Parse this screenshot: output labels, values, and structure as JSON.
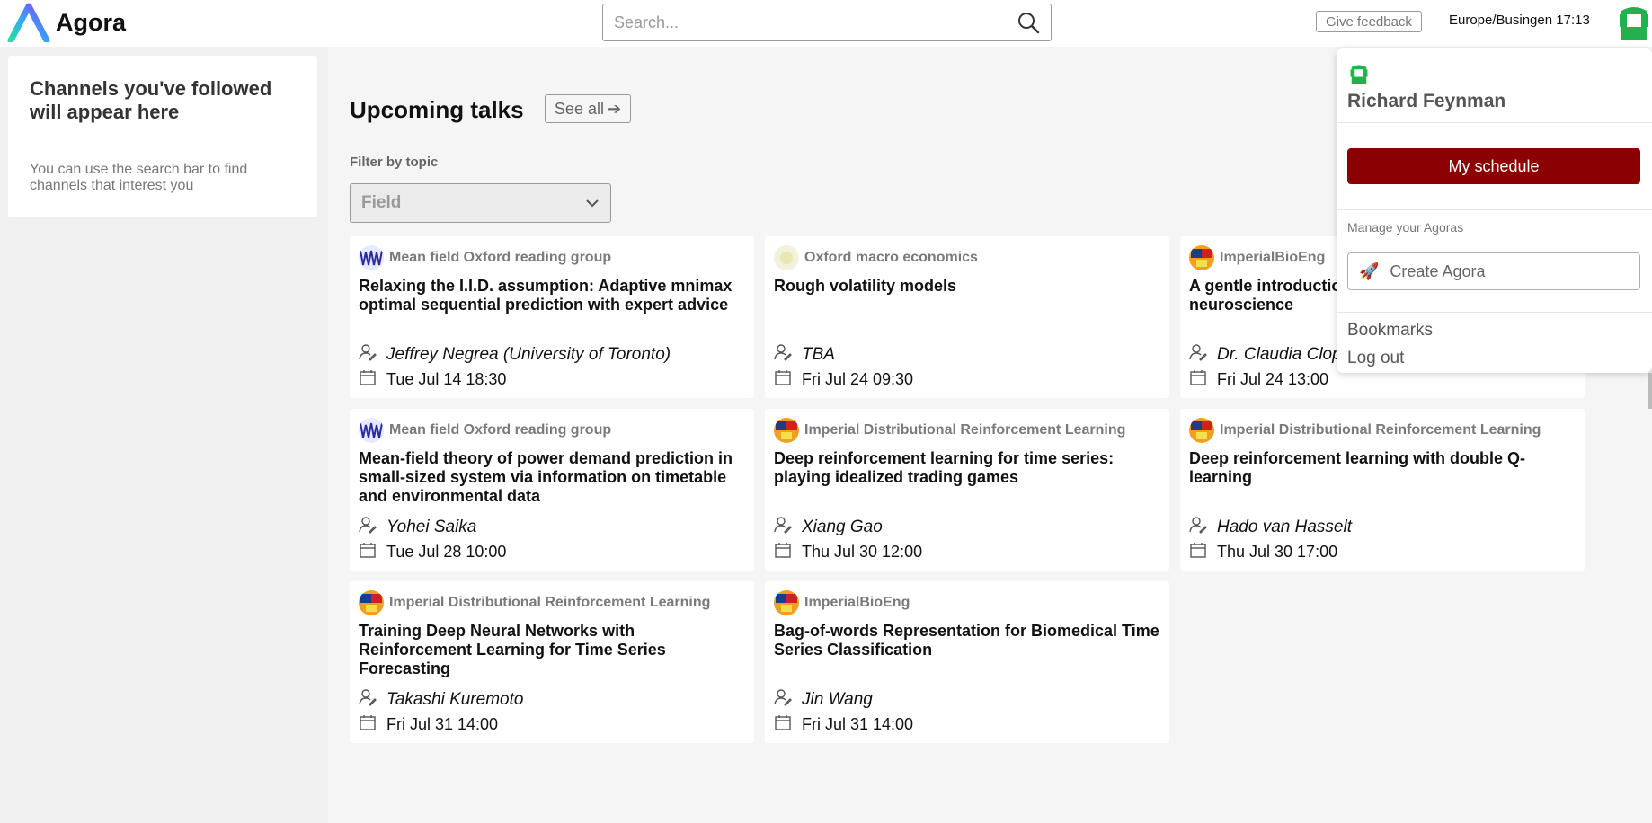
{
  "header": {
    "logo_text": "Agora",
    "search_placeholder": "Search...",
    "feedback_label": "Give feedback",
    "timezone_time": "Europe/Busingen 17:13"
  },
  "sidebar": {
    "follow_title": "Channels you've followed will appear here",
    "follow_hint": "You can use the search bar to find channels that interest you"
  },
  "main": {
    "section_title": "Upcoming talks",
    "see_all_label": "See all",
    "filter_label": "Filter by topic",
    "filter_value": "Field"
  },
  "talks": [
    {
      "channel": "Mean field Oxford reading group",
      "avatar": "waves-avatar",
      "title": "Relaxing the I.I.D. assumption: Adaptive mnimax optimal sequential prediction with expert advice",
      "speaker": "Jeffrey Negrea (University of Toronto)",
      "date": "Tue Jul 14 18:30"
    },
    {
      "channel": "Oxford macro economics",
      "avatar": "pale-avatar",
      "title": "Rough volatility models",
      "speaker": "TBA",
      "date": "Fri Jul 24 09:30"
    },
    {
      "channel": "ImperialBioEng",
      "avatar": "imperial-avatar",
      "title": "A gentle introduction to computational neuroscience",
      "speaker": "Dr. Claudia Clopath",
      "date": "Fri Jul 24 13:00"
    },
    {
      "channel": "Mean field Oxford reading group",
      "avatar": "waves-avatar",
      "title": "Mean-field theory of power demand prediction in small-sized system via information on timetable and environmental data",
      "speaker": "Yohei Saika",
      "date": "Tue Jul 28 10:00"
    },
    {
      "channel": "Imperial Distributional Reinforcement Learning",
      "avatar": "imperial-avatar",
      "title": "Deep reinforcement learning for time series: playing idealized trading games",
      "speaker": "Xiang Gao",
      "date": "Thu Jul 30 12:00"
    },
    {
      "channel": "Imperial Distributional Reinforcement Learning",
      "avatar": "imperial-avatar",
      "title": "Deep reinforcement learning with double Q-learning",
      "speaker": "Hado van Hasselt",
      "date": "Thu Jul 30 17:00"
    },
    {
      "channel": "Imperial Distributional Reinforcement Learning",
      "avatar": "imperial-avatar",
      "title": "Training Deep Neural Networks with Reinforcement Learning for Time Series Forecasting",
      "speaker": "Takashi Kuremoto",
      "date": "Fri Jul 31 14:00"
    },
    {
      "channel": "ImperialBioEng",
      "avatar": "imperial-avatar",
      "title": "Bag-of-words Representation for Biomedical Time Series Classification",
      "speaker": "Jin Wang",
      "date": "Fri Jul 31 14:00"
    }
  ],
  "user_menu": {
    "user_name": "Richard Feynman",
    "schedule_label": "My schedule",
    "manage_label": "Manage your Agoras",
    "create_label": "Create Agora",
    "bookmarks_label": "Bookmarks",
    "logout_label": "Log out"
  },
  "colors": {
    "brand_green": "#22b14c",
    "schedule_red": "#8b0000",
    "background": "#f5f5f5"
  }
}
